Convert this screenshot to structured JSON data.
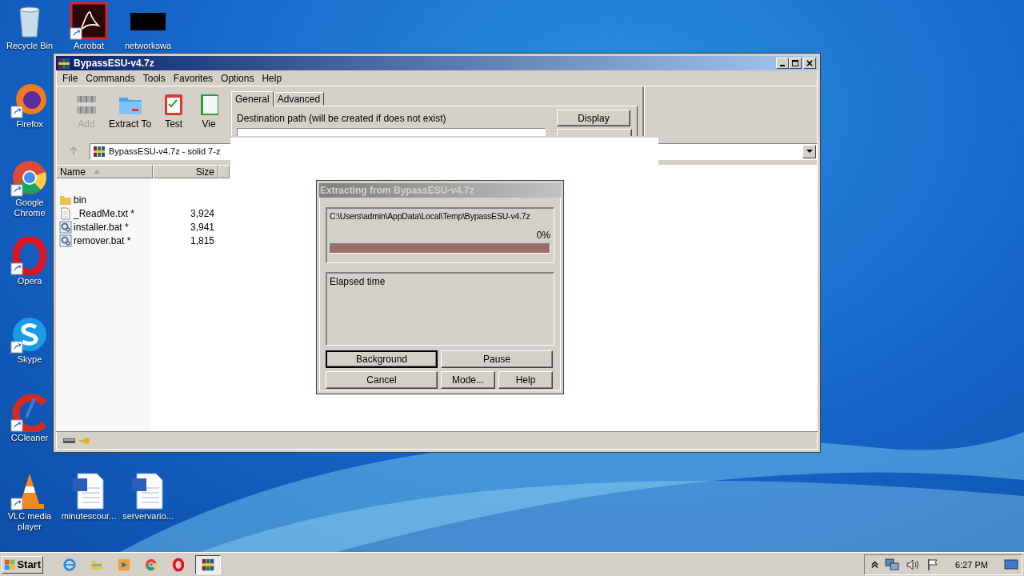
{
  "desktop_icons": [
    {
      "label": "Recycle Bin",
      "kind": "recycle",
      "shortcut": false
    },
    {
      "label": "Acrobat",
      "kind": "acrobat",
      "shortcut": true
    },
    {
      "label": "networkswa",
      "kind": "blank",
      "shortcut": false
    },
    {
      "label": "Firefox",
      "kind": "firefox",
      "shortcut": true
    },
    {
      "label": "Google Chrome",
      "kind": "chrome",
      "shortcut": true
    },
    {
      "label": "Opera",
      "kind": "opera",
      "shortcut": true
    },
    {
      "label": "Skype",
      "kind": "skype",
      "shortcut": true
    },
    {
      "label": "CCleaner",
      "kind": "ccleaner",
      "shortcut": true
    },
    {
      "label": "VLC media player",
      "kind": "vlc",
      "shortcut": true
    },
    {
      "label": "minutescour...",
      "kind": "word",
      "shortcut": false
    },
    {
      "label": "servervario...",
      "kind": "word",
      "shortcut": false
    }
  ],
  "window": {
    "title": "BypassESU-v4.7z",
    "menu": [
      "File",
      "Commands",
      "Tools",
      "Favorites",
      "Options",
      "Help"
    ],
    "toolbar": [
      {
        "label": "Add",
        "kind": "add",
        "disabled": true
      },
      {
        "label": "Extract To",
        "kind": "extract",
        "disabled": false
      },
      {
        "label": "Test",
        "kind": "test",
        "disabled": false
      },
      {
        "label": "Vie",
        "kind": "view",
        "disabled": false
      }
    ],
    "options_panel": {
      "tabs": [
        {
          "label": "General",
          "selected": true
        },
        {
          "label": "Advanced",
          "selected": false
        }
      ],
      "destination_label": "Destination path (will be created if does not exist)",
      "button": "Display"
    },
    "address": "BypassESU-v4.7z - solid 7-z",
    "columns": [
      "Name",
      "Size"
    ],
    "rows": [
      {
        "name": "bin",
        "kind": "folder"
      },
      {
        "name": "_ReadMe.txt *",
        "size": "3,924",
        "kind": "text"
      },
      {
        "name": "installer.bat *",
        "size": "3,941",
        "kind": "batch"
      },
      {
        "name": "remover.bat *",
        "size": "1,815",
        "kind": "batch"
      }
    ]
  },
  "dialog": {
    "title": "Extracting from BypassESU-v4.7z",
    "path": "C:\\Users\\admin\\AppData\\Local\\Temp\\BypassESU-v4.7z",
    "percent": "0%",
    "level": 1,
    "elapsed_label": "Elapsed time",
    "buttons": [
      {
        "label": "Background",
        "default": true
      },
      {
        "label": "Pause",
        "default": false
      },
      {
        "label": "Cancel",
        "default": false
      },
      {
        "label": "Mode...",
        "default": false
      },
      {
        "label": "Help",
        "default": false
      }
    ]
  },
  "taskbar": {
    "start": "Start",
    "apps": [
      {
        "kind": "ie",
        "active": false
      },
      {
        "kind": "explorer",
        "active": false
      },
      {
        "kind": "media",
        "active": false
      },
      {
        "kind": "chrome",
        "active": false
      },
      {
        "kind": "opera",
        "active": false
      },
      {
        "kind": "archiver",
        "active": true
      }
    ],
    "time": "6:27 PM"
  }
}
